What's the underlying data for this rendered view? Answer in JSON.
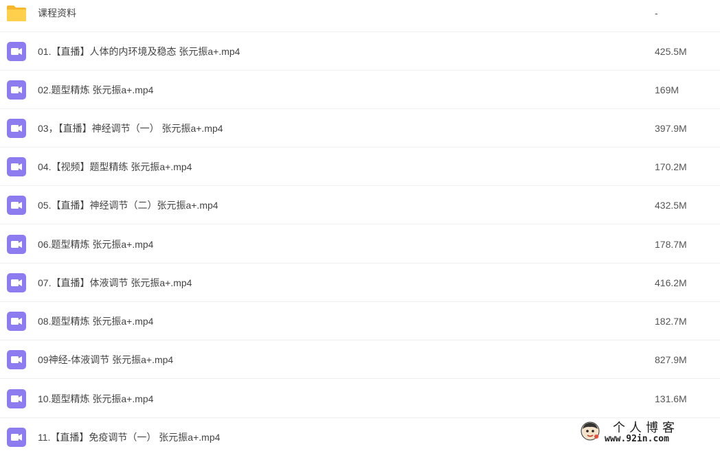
{
  "colors": {
    "folder": "#FFD04B",
    "video": "#8C7CF0",
    "text": "#444444"
  },
  "files": [
    {
      "icon": "folder-icon",
      "name": "课程资料",
      "size": "-"
    },
    {
      "icon": "video-file-icon",
      "name": "01.【直播】人体的内环境及稳态 张元振a+.mp4",
      "size": "425.5M"
    },
    {
      "icon": "video-file-icon",
      "name": "02.题型精炼 张元振a+.mp4",
      "size": "169M"
    },
    {
      "icon": "video-file-icon",
      "name": "03，【直播】神经调节（一） 张元振a+.mp4",
      "size": "397.9M"
    },
    {
      "icon": "video-file-icon",
      "name": "04.【视频】题型精练 张元振a+.mp4",
      "size": "170.2M"
    },
    {
      "icon": "video-file-icon",
      "name": "05.【直播】神经调节（二）张元振a+.mp4",
      "size": "432.5M"
    },
    {
      "icon": "video-file-icon",
      "name": "06.题型精炼 张元振a+.mp4",
      "size": "178.7M"
    },
    {
      "icon": "video-file-icon",
      "name": "07.【直播】体液调节 张元振a+.mp4",
      "size": "416.2M"
    },
    {
      "icon": "video-file-icon",
      "name": "08.题型精炼 张元振a+.mp4",
      "size": "182.7M"
    },
    {
      "icon": "video-file-icon",
      "name": "09神经-体液调节 张元振a+.mp4",
      "size": "827.9M"
    },
    {
      "icon": "video-file-icon",
      "name": "10.题型精炼 张元振a+.mp4",
      "size": "131.6M"
    },
    {
      "icon": "video-file-icon",
      "name": "11.【直播】免疫调节（一） 张元振a+.mp4",
      "size": ""
    }
  ],
  "watermark": {
    "title": "个人博客",
    "url": "www.92in.com"
  }
}
